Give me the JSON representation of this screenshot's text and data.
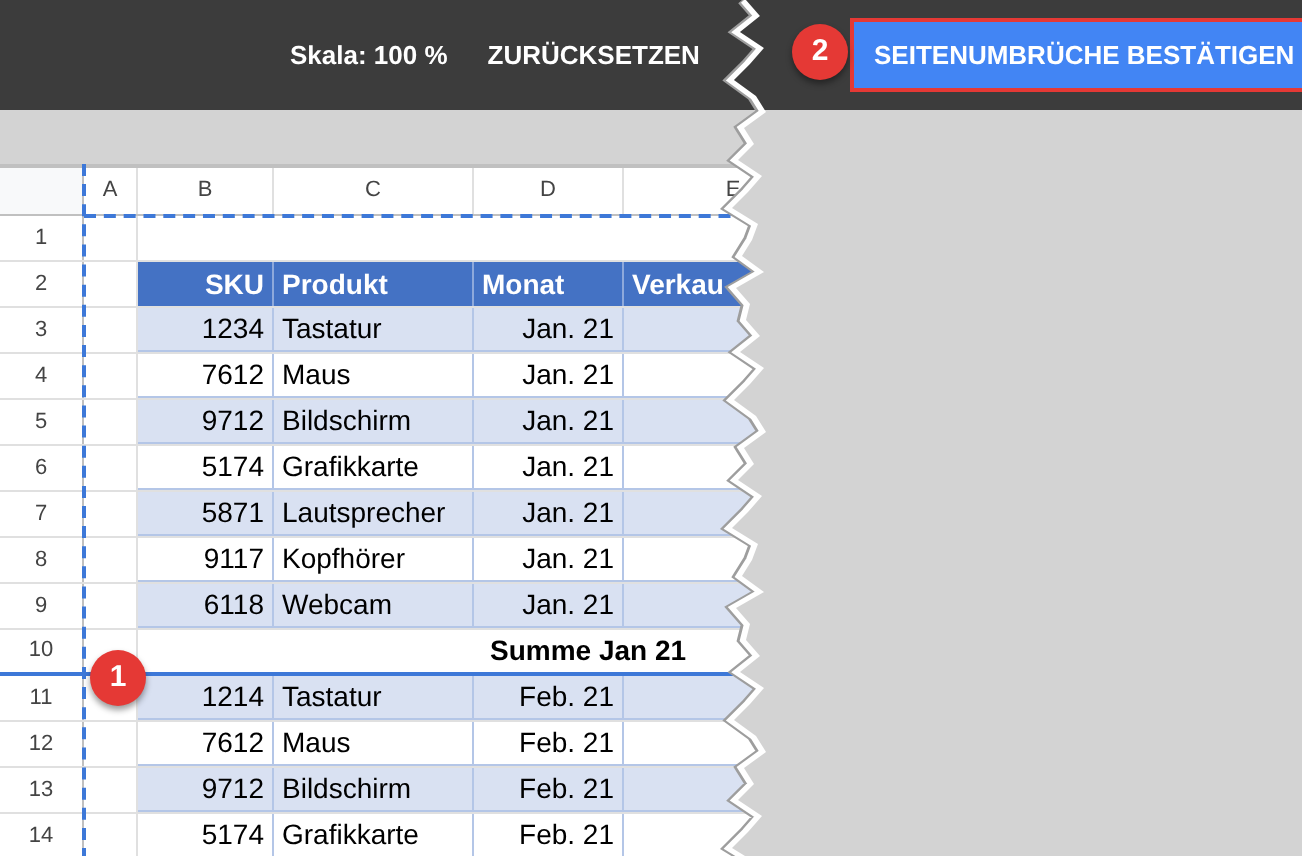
{
  "toolbar": {
    "scale_label": "Skala: 100 %",
    "reset_button": "ZURÜCKSETZEN",
    "confirm_button": "SEITENUMBRÜCHE BESTÄTIGEN"
  },
  "callouts": [
    {
      "label": "1"
    },
    {
      "label": "2"
    }
  ],
  "sheet": {
    "columns": [
      "A",
      "B",
      "C",
      "D",
      "E"
    ],
    "rows": [
      {
        "number": "1",
        "kind": "empty",
        "page_break": false,
        "cells": []
      },
      {
        "number": "2",
        "kind": "header",
        "page_break": false,
        "cells": [
          "",
          "SKU",
          "Produkt",
          "Monat",
          "Verkau"
        ]
      },
      {
        "number": "3",
        "kind": "item",
        "shaded": true,
        "page_break": false,
        "cells": [
          "",
          "1234",
          "Tastatur",
          "Jan. 21"
        ]
      },
      {
        "number": "4",
        "kind": "item",
        "shaded": false,
        "page_break": false,
        "cells": [
          "",
          "7612",
          "Maus",
          "Jan. 21"
        ]
      },
      {
        "number": "5",
        "kind": "item",
        "shaded": true,
        "page_break": false,
        "cells": [
          "",
          "9712",
          "Bildschirm",
          "Jan. 21"
        ]
      },
      {
        "number": "6",
        "kind": "item",
        "shaded": false,
        "page_break": false,
        "cells": [
          "",
          "5174",
          "Grafikkarte",
          "Jan. 21"
        ]
      },
      {
        "number": "7",
        "kind": "item",
        "shaded": true,
        "page_break": false,
        "cells": [
          "",
          "5871",
          "Lautsprecher",
          "Jan. 21"
        ]
      },
      {
        "number": "8",
        "kind": "item",
        "shaded": false,
        "page_break": false,
        "cells": [
          "",
          "9117",
          "Kopfhörer",
          "Jan. 21"
        ]
      },
      {
        "number": "9",
        "kind": "item",
        "shaded": true,
        "page_break": false,
        "cells": [
          "",
          "6118",
          "Webcam",
          "Jan. 21"
        ]
      },
      {
        "number": "10",
        "kind": "total",
        "shaded": false,
        "page_break": true,
        "cells": [
          "",
          "",
          "",
          "Summe Jan 21"
        ]
      },
      {
        "number": "11",
        "kind": "item",
        "shaded": true,
        "page_break": false,
        "cells": [
          "",
          "1214",
          "Tastatur",
          "Feb. 21"
        ]
      },
      {
        "number": "12",
        "kind": "item",
        "shaded": false,
        "page_break": false,
        "cells": [
          "",
          "7612",
          "Maus",
          "Feb. 21"
        ]
      },
      {
        "number": "13",
        "kind": "item",
        "shaded": true,
        "page_break": false,
        "cells": [
          "",
          "9712",
          "Bildschirm",
          "Feb. 21"
        ]
      },
      {
        "number": "14",
        "kind": "item",
        "shaded": false,
        "page_break": false,
        "cells": [
          "",
          "5174",
          "Grafikkarte",
          "Feb. 21"
        ]
      }
    ]
  }
}
